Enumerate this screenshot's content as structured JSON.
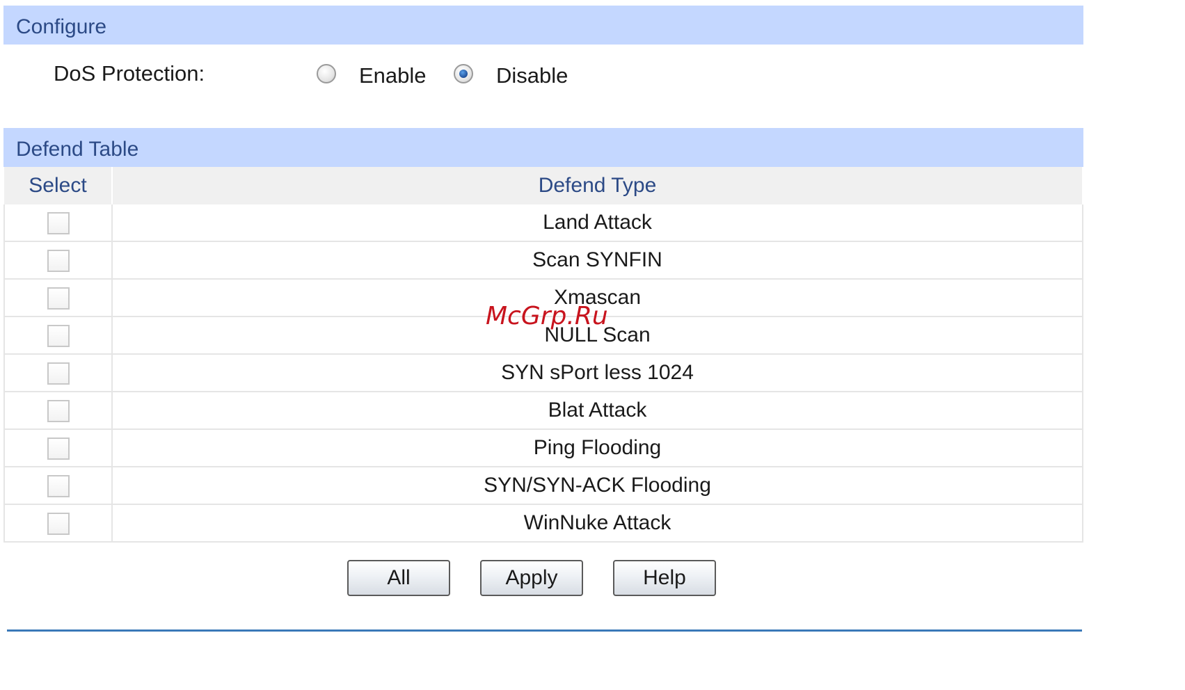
{
  "configure": {
    "title": "Configure",
    "dos_label": "DoS Protection:",
    "enable_label": "Enable",
    "disable_label": "Disable",
    "selected": "Disable"
  },
  "defend_table": {
    "title": "Defend Table",
    "columns": [
      "Select",
      "Defend Type"
    ],
    "rows": [
      {
        "type": "Land Attack",
        "checked": false
      },
      {
        "type": "Scan SYNFIN",
        "checked": false
      },
      {
        "type": "Xmascan",
        "checked": false
      },
      {
        "type": "NULL Scan",
        "checked": false
      },
      {
        "type": "SYN sPort less 1024",
        "checked": false
      },
      {
        "type": "Blat Attack",
        "checked": false
      },
      {
        "type": "Ping Flooding",
        "checked": false
      },
      {
        "type": "SYN/SYN-ACK Flooding",
        "checked": false
      },
      {
        "type": "WinNuke Attack",
        "checked": false
      }
    ]
  },
  "buttons": {
    "all": "All",
    "apply": "Apply",
    "help": "Help"
  },
  "watermark": "McGrp.Ru",
  "colors": {
    "header_bg": "#c4d7ff",
    "header_text": "#2c4a86",
    "accent_line": "#3a78b8"
  }
}
